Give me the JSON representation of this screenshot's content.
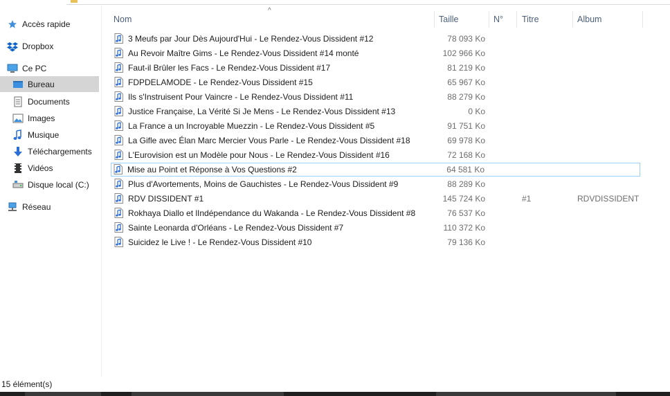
{
  "nav": {
    "items": [
      {
        "label": "Accès rapide",
        "icon": "star-icon"
      },
      {
        "label": "Dropbox",
        "icon": "dropbox-icon"
      },
      {
        "label": "Ce PC",
        "icon": "computer-icon"
      },
      {
        "label": "Bureau",
        "icon": "desktop-folder-icon"
      },
      {
        "label": "Documents",
        "icon": "documents-icon"
      },
      {
        "label": "Images",
        "icon": "images-icon"
      },
      {
        "label": "Musique",
        "icon": "music-icon"
      },
      {
        "label": "Téléchargements",
        "icon": "download-icon"
      },
      {
        "label": "Vidéos",
        "icon": "videos-icon"
      },
      {
        "label": "Disque local (C:)",
        "icon": "drive-icon"
      },
      {
        "label": "Réseau",
        "icon": "network-icon"
      }
    ]
  },
  "columns": {
    "name": "Nom",
    "size": "Taille",
    "number": "N°",
    "title": "Titre",
    "album": "Album"
  },
  "files": [
    {
      "name": "3 Meufs par Jour Dès Aujourd'Hui - Le Rendez-Vous Dissident #12",
      "size": "78 093 Ko",
      "number": "",
      "album": ""
    },
    {
      "name": "Au Revoir Maître Gims - Le Rendez-Vous Dissident #14 monté",
      "size": "102 966 Ko",
      "number": "",
      "album": ""
    },
    {
      "name": "Faut-il Brûler les Facs  - Le Rendez-Vous Dissident #17",
      "size": "81 219 Ko",
      "number": "",
      "album": ""
    },
    {
      "name": "FDPDELAMODE - Le Rendez-Vous Dissident #15",
      "size": "65 967 Ko",
      "number": "",
      "album": ""
    },
    {
      "name": "Ils s'Instruisent Pour Vaincre - Le Rendez-Vous Dissident #11",
      "size": "88 279 Ko",
      "number": "",
      "album": ""
    },
    {
      "name": "Justice Française, La Vérité Si Je Mens - Le Rendez-Vous Dissident #13",
      "size": "0 Ko",
      "number": "",
      "album": ""
    },
    {
      "name": "La France a un Incroyable Muezzin - Le Rendez-Vous Dissident #5",
      "size": "91 751 Ko",
      "number": "",
      "album": ""
    },
    {
      "name": "La Gifle avec Élan  Marc Mercier Vous Parle - Le Rendez-Vous Dissident #18",
      "size": "69 978 Ko",
      "number": "",
      "album": ""
    },
    {
      "name": "L'Eurovision est un Modèle pour Nous - Le Rendez-Vous Dissident #16",
      "size": "72 168 Ko",
      "number": "",
      "album": ""
    },
    {
      "name": "Mise au Point et Réponse à Vos Questions #2",
      "size": "64 581 Ko",
      "number": "",
      "album": ""
    },
    {
      "name": "Plus d'Avortements, Moins de Gauchistes - Le Rendez-Vous Dissident #9",
      "size": "88 289 Ko",
      "number": "",
      "album": ""
    },
    {
      "name": "RDV DISSIDENT #1",
      "size": "145 724 Ko",
      "number": "#1",
      "album": "RDVDISSIDENT"
    },
    {
      "name": "Rokhaya Diallo et lIndépendance du Wakanda - Le Rendez-Vous Dissident #8",
      "size": "76 537 Ko",
      "number": "",
      "album": ""
    },
    {
      "name": "Sainte Leonarda d'Orléans - Le Rendez-Vous Dissident #7",
      "size": "110 372 Ko",
      "number": "",
      "album": ""
    },
    {
      "name": "Suicidez le Live ! - Le Rendez-Vous Dissident #10",
      "size": "79 136 Ko",
      "number": "",
      "album": ""
    }
  ],
  "status": {
    "count": "15 élément(s)"
  },
  "colors": {
    "header_text": "#4c607a",
    "selected_nav": "#d9d9d9",
    "focus_border": "#99d1ff",
    "audio_icon": "#2b6fd6"
  }
}
